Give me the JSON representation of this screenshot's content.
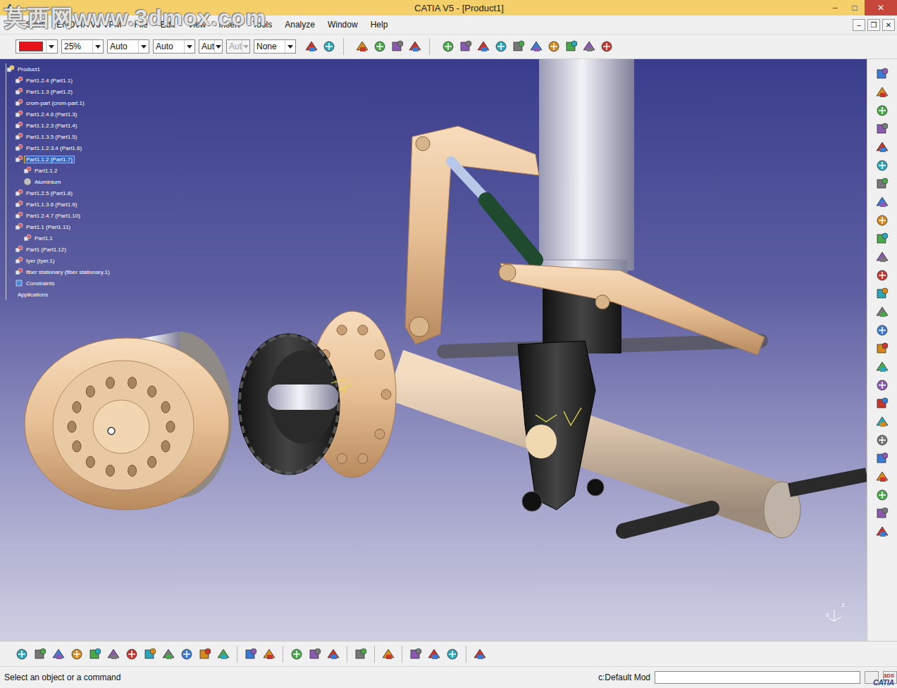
{
  "window": {
    "title": "CATIA V5 - [Product1]",
    "controls": [
      "–",
      "□",
      "✕"
    ]
  },
  "watermark": "莫西网www.3dmox.com",
  "menu": {
    "items": [
      "Start",
      "ENOVIA V5 VPM",
      "File",
      "Edit",
      "View",
      "Insert",
      "Tools",
      "Analyze",
      "Window",
      "Help"
    ],
    "doc_controls": [
      "–",
      "❐",
      "✕"
    ]
  },
  "toolbar": {
    "color": "#e8121a",
    "fields": [
      {
        "value": "25%",
        "disabled": false
      },
      {
        "value": "Auto",
        "disabled": false
      },
      {
        "value": "Auto",
        "disabled": false
      },
      {
        "value": "Aut",
        "disabled": false
      },
      {
        "value": "Aut",
        "disabled": true
      },
      {
        "value": "None",
        "disabled": false
      }
    ]
  },
  "tree": {
    "items": [
      {
        "label": "Product1",
        "depth": 0,
        "kind": "product",
        "selected": false
      },
      {
        "label": "Part1.2.4 (Part1.1)",
        "depth": 1,
        "kind": "part",
        "selected": false
      },
      {
        "label": "Part1.1.3 (Part1.2)",
        "depth": 1,
        "kind": "part",
        "selected": false
      },
      {
        "label": "crom-part (crom-part.1)",
        "depth": 1,
        "kind": "part",
        "selected": false
      },
      {
        "label": "Part1.2.4.6 (Part1.3)",
        "depth": 1,
        "kind": "part",
        "selected": false
      },
      {
        "label": "Part1.1.2.3 (Part1.4)",
        "depth": 1,
        "kind": "part",
        "selected": false
      },
      {
        "label": "Part1.1.3.5 (Part1.5)",
        "depth": 1,
        "kind": "part",
        "selected": false
      },
      {
        "label": "Part1.1.2.3.4 (Part1.6)",
        "depth": 1,
        "kind": "part",
        "selected": false
      },
      {
        "label": "Part1.1.2 (Part1.7)",
        "depth": 1,
        "kind": "part",
        "selected": true
      },
      {
        "label": "Part1.1.2",
        "depth": 2,
        "kind": "body",
        "selected": false
      },
      {
        "label": "Aluminium",
        "depth": 2,
        "kind": "material",
        "selected": false
      },
      {
        "label": "Part1.2.5 (Part1.8)",
        "depth": 1,
        "kind": "part",
        "selected": false
      },
      {
        "label": "Part1.1.3.6 (Part1.9)",
        "depth": 1,
        "kind": "part",
        "selected": false
      },
      {
        "label": "Part1.2.4.7 (Part1.10)",
        "depth": 1,
        "kind": "part",
        "selected": false
      },
      {
        "label": "Part1.1 (Part1.11)",
        "depth": 1,
        "kind": "part",
        "selected": false
      },
      {
        "label": "Part1.1",
        "depth": 2,
        "kind": "body",
        "selected": false
      },
      {
        "label": "Part1 (Part1.12)",
        "depth": 1,
        "kind": "part",
        "selected": false
      },
      {
        "label": "tyer (tyer.1)",
        "depth": 1,
        "kind": "part",
        "selected": false
      },
      {
        "label": "fiber stationary (fiber stationary.1)",
        "depth": 1,
        "kind": "part",
        "selected": false
      },
      {
        "label": "Constraints",
        "depth": 1,
        "kind": "constraints",
        "selected": false
      },
      {
        "label": "Applications",
        "depth": 0,
        "kind": "applications",
        "selected": false
      }
    ]
  },
  "compass": {
    "x": "x",
    "z": "z"
  },
  "logo": {
    "mark": "3DS",
    "name": "CATIA"
  },
  "status_bar": {
    "prompt": "Select an object or a command",
    "mode": "c:Default Mod",
    "command": ""
  }
}
